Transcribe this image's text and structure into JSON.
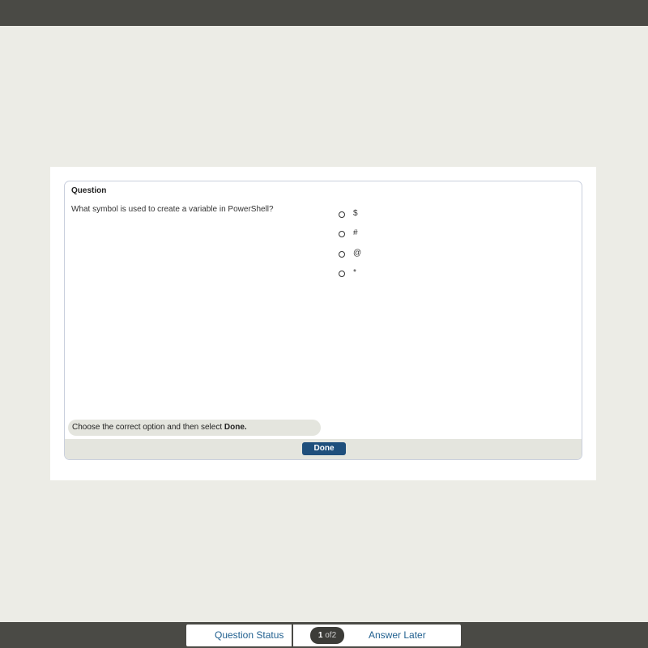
{
  "panel": {
    "title": "Question",
    "question": "What symbol is used to create a variable in PowerShell?",
    "options": [
      {
        "label": "$",
        "selected": false
      },
      {
        "label": "#",
        "selected": false
      },
      {
        "label": "@",
        "selected": false
      },
      {
        "label": "*",
        "selected": false
      }
    ],
    "instruction_prefix": "Choose the correct option and then select ",
    "instruction_bold": "Done.",
    "done_label": "Done"
  },
  "footer": {
    "question_status_label": "Question Status",
    "current_page": "1",
    "of_text": "of",
    "total_pages": "2",
    "answer_later_label": "Answer Later"
  },
  "colors": {
    "background": "#ecece6",
    "bars": "#4a4a45",
    "done_button": "#1f4f7c",
    "link": "#1f5f8f"
  }
}
